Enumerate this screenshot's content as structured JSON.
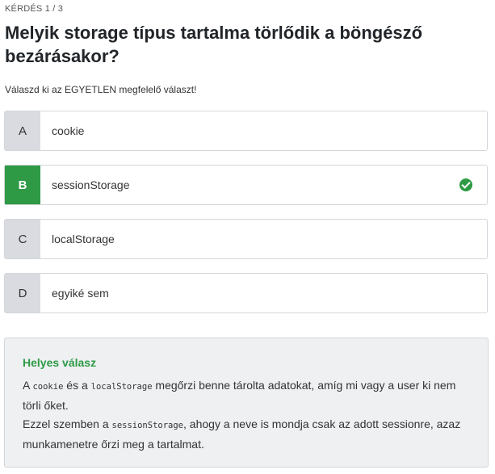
{
  "quiz": {
    "counter": "KÉRDÉS 1 / 3",
    "question": "Melyik storage típus tartalma törlődik a böngésző bezárásakor?",
    "instruction": "Válaszd ki az EGYETLEN megfelelő választ!"
  },
  "options": [
    {
      "letter": "A",
      "text": "cookie"
    },
    {
      "letter": "B",
      "text": "sessionStorage",
      "correct": true,
      "status_icon": "check-circle-icon"
    },
    {
      "letter": "C",
      "text": "localStorage"
    },
    {
      "letter": "D",
      "text": "egyiké sem"
    }
  ],
  "answer": {
    "title": "Helyes válasz",
    "line1": {
      "p1": "A ",
      "code1": "cookie",
      "p2": " és a ",
      "code2": "localStorage",
      "p3": " megőrzi benne tárolta adatokat, amíg mi vagy a user ki nem törli őket."
    },
    "line2": {
      "p1": "Ezzel szemben a ",
      "code1": "sessionStorage",
      "p2": ", ahogy a neve is mondja csak az adott sessionre, azaz munkamenetre őrzi meg a tartalmat."
    }
  },
  "colors": {
    "correct": "#2e9a45",
    "letter_bg": "#d9dbe0",
    "answer_bg": "#eef0f2"
  }
}
